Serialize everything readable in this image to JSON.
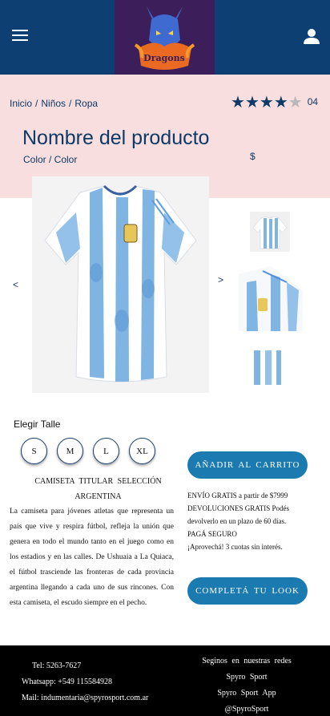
{
  "header": {
    "menu_icon": "hamburger-menu-icon",
    "logo_text": "Dragons",
    "user_icon": "user-account-icon",
    "colors": {
      "background": "#0d3f73",
      "logo_background": "#3b1e5a"
    }
  },
  "breadcrumb": {
    "items": [
      "Inicio",
      "Niños",
      "Ropa"
    ],
    "separator": "/"
  },
  "rating": {
    "stars_filled": 4,
    "stars_total": 5,
    "count": "04"
  },
  "product": {
    "title": "Nombre del producto",
    "color": "Color / Color",
    "price": "$"
  },
  "gallery": {
    "prev_arrow": "<",
    "next_arrow": ">"
  },
  "size": {
    "label": "Elegir Talle",
    "options": [
      "S",
      "M",
      "L",
      "XL"
    ]
  },
  "description": {
    "title": "CAMISETA TITULAR SELECCIÓN ARGENTINA",
    "body": "La camiseta para jóvenes atletas que representa un país que vive y respira fútbol, refleja la unión que genera en todo el mundo tanto en el juego como en los estadios y en las calles. De Ushuaia a La Quiaca, el fútbol trasciende las fronteras de cada provincia argentina llegando a cada uno de sus rincones. Con esta camiseta, el escudo siempre en el pecho."
  },
  "actions": {
    "add_to_cart": "AÑADIR AL CARRITO",
    "complete_look": "COMPLETÁ TU LOOK",
    "accent_color": "#1b7bb1"
  },
  "shipping": {
    "line1": "ENVÍO GRATIS a partir de $7999",
    "line2": "DEVOLUCIONES GRATIS Podés devolverlo en un plazo de 60 días.",
    "line3": "PAGÁ SEGURO",
    "line4": "¡Aprovechá! 3 cuotas sin interés."
  },
  "footer": {
    "phone": "Tel: 5263-7627",
    "whatsapp": "Whatsapp: +549 115584928",
    "mail": "Mail: indumentaria@spyrosport.com.ar",
    "follow": "Seginos en nuestras redes",
    "social1": "Spyro Sport",
    "social2": "Spyro Sport App",
    "social3": "@SpyroSport"
  }
}
